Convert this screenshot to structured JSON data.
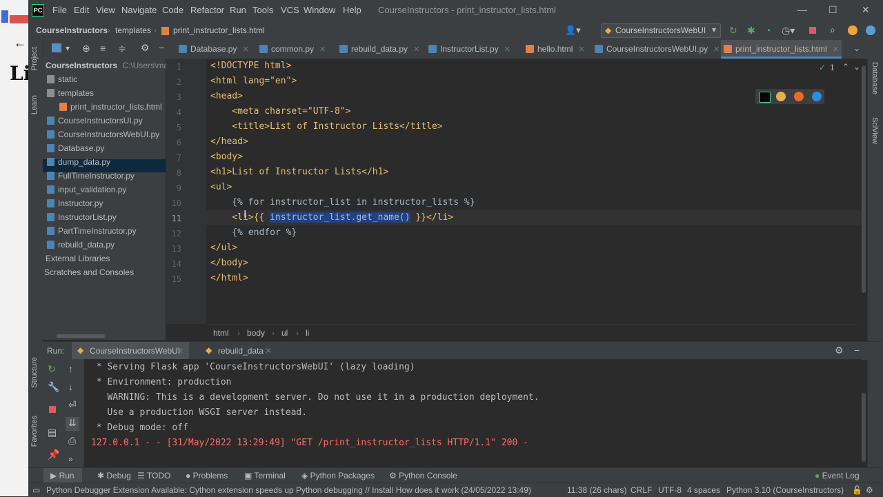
{
  "window": {
    "title": "CourseInstructors - print_instructor_lists.html",
    "menu": [
      "File",
      "Edit",
      "View",
      "Navigate",
      "Code",
      "Refactor",
      "Run",
      "Tools",
      "VCS",
      "Window",
      "Help"
    ]
  },
  "nav": {
    "breadcrumb": [
      "CourseInstructors",
      "templates",
      "print_instructor_lists.html"
    ],
    "run_config": "CourseInstructorsWebUI"
  },
  "tabs": [
    "Database.py",
    "common.py",
    "rebuild_data.py",
    "InstructorList.py",
    "hello.html",
    "CourseInstructorsWebUI.py",
    "print_instructor_lists.html"
  ],
  "left_tools": [
    "Project",
    "Learn",
    "Structure",
    "Favorites"
  ],
  "right_tools": [
    "Database",
    "SciView"
  ],
  "project": {
    "root": "CourseInstructors",
    "root_path": "C:\\Users\\mar",
    "items": [
      {
        "label": "static",
        "type": "folder"
      },
      {
        "label": "templates",
        "type": "folder"
      },
      {
        "label": "print_instructor_lists.html",
        "type": "html"
      },
      {
        "label": "CourseInstructorsUI.py",
        "type": "py"
      },
      {
        "label": "CourseInstructorsWebUI.py",
        "type": "py"
      },
      {
        "label": "Database.py",
        "type": "py"
      },
      {
        "label": "dump_data.py",
        "type": "py"
      },
      {
        "label": "FullTimeInstructor.py",
        "type": "py"
      },
      {
        "label": "input_validation.py",
        "type": "py"
      },
      {
        "label": "Instructor.py",
        "type": "py"
      },
      {
        "label": "InstructorList.py",
        "type": "py"
      },
      {
        "label": "PartTimeInstructor.py",
        "type": "py"
      },
      {
        "label": "rebuild_data.py",
        "type": "py"
      }
    ],
    "external": "External Libraries",
    "scratches": "Scratches and Consoles"
  },
  "editor": {
    "line_numbers": [
      "1",
      "2",
      "3",
      "4",
      "5",
      "6",
      "7",
      "8",
      "9",
      "10",
      "11",
      "12",
      "13",
      "14",
      "15"
    ],
    "lines": [
      "<!DOCTYPE html>",
      "<html lang=\"en\">",
      "<head>",
      "    <meta charset=\"UTF-8\">",
      "    <title>List of Instructor Lists</title>",
      "</head>",
      "<body>",
      "<h1>List of Instructor Lists</h1>",
      "<ul>",
      "    {% for instructor_list in instructor_lists %}",
      "    <li>{{ ",
      "    {% endfor %}",
      "</ul>",
      "</body>",
      "</html>"
    ],
    "selected_text": "instructor_list.get_name()",
    "line11_tail": " }}</li>",
    "inspection_count": "1"
  },
  "breadcrumbs": [
    "html",
    "body",
    "ul",
    "li"
  ],
  "run": {
    "label": "Run:",
    "tabs": [
      "CourseInstructorsWebUI",
      "rebuild_data"
    ],
    "console": [
      " * Serving Flask app 'CourseInstructorsWebUI' (lazy loading)",
      " * Environment: production",
      "   WARNING: This is a development server. Do not use it in a production deployment.",
      "   Use a production WSGI server instead.",
      " * Debug mode: off"
    ],
    "console_error": "127.0.0.1 - - [31/May/2022 13:29:49] \"GET /print_instructor_lists HTTP/1.1\" 200 -"
  },
  "bottom_tabs": [
    "Run",
    "Debug",
    "TODO",
    "Problems",
    "Terminal",
    "Python Packages",
    "Python Console"
  ],
  "event_log": "Event Log",
  "status": {
    "message": "Python Debugger Extension Available: Cython extension speeds up Python debugging // Install   How does it work (24/05/2022 13:49)",
    "position": "11:38 (26 chars)",
    "line_sep": "CRLF",
    "encoding": "UTF-8",
    "indent": "4 spaces",
    "interpreter": "Python 3.10 (CourseInstructors)"
  },
  "background_page": {
    "heading": "Li"
  }
}
